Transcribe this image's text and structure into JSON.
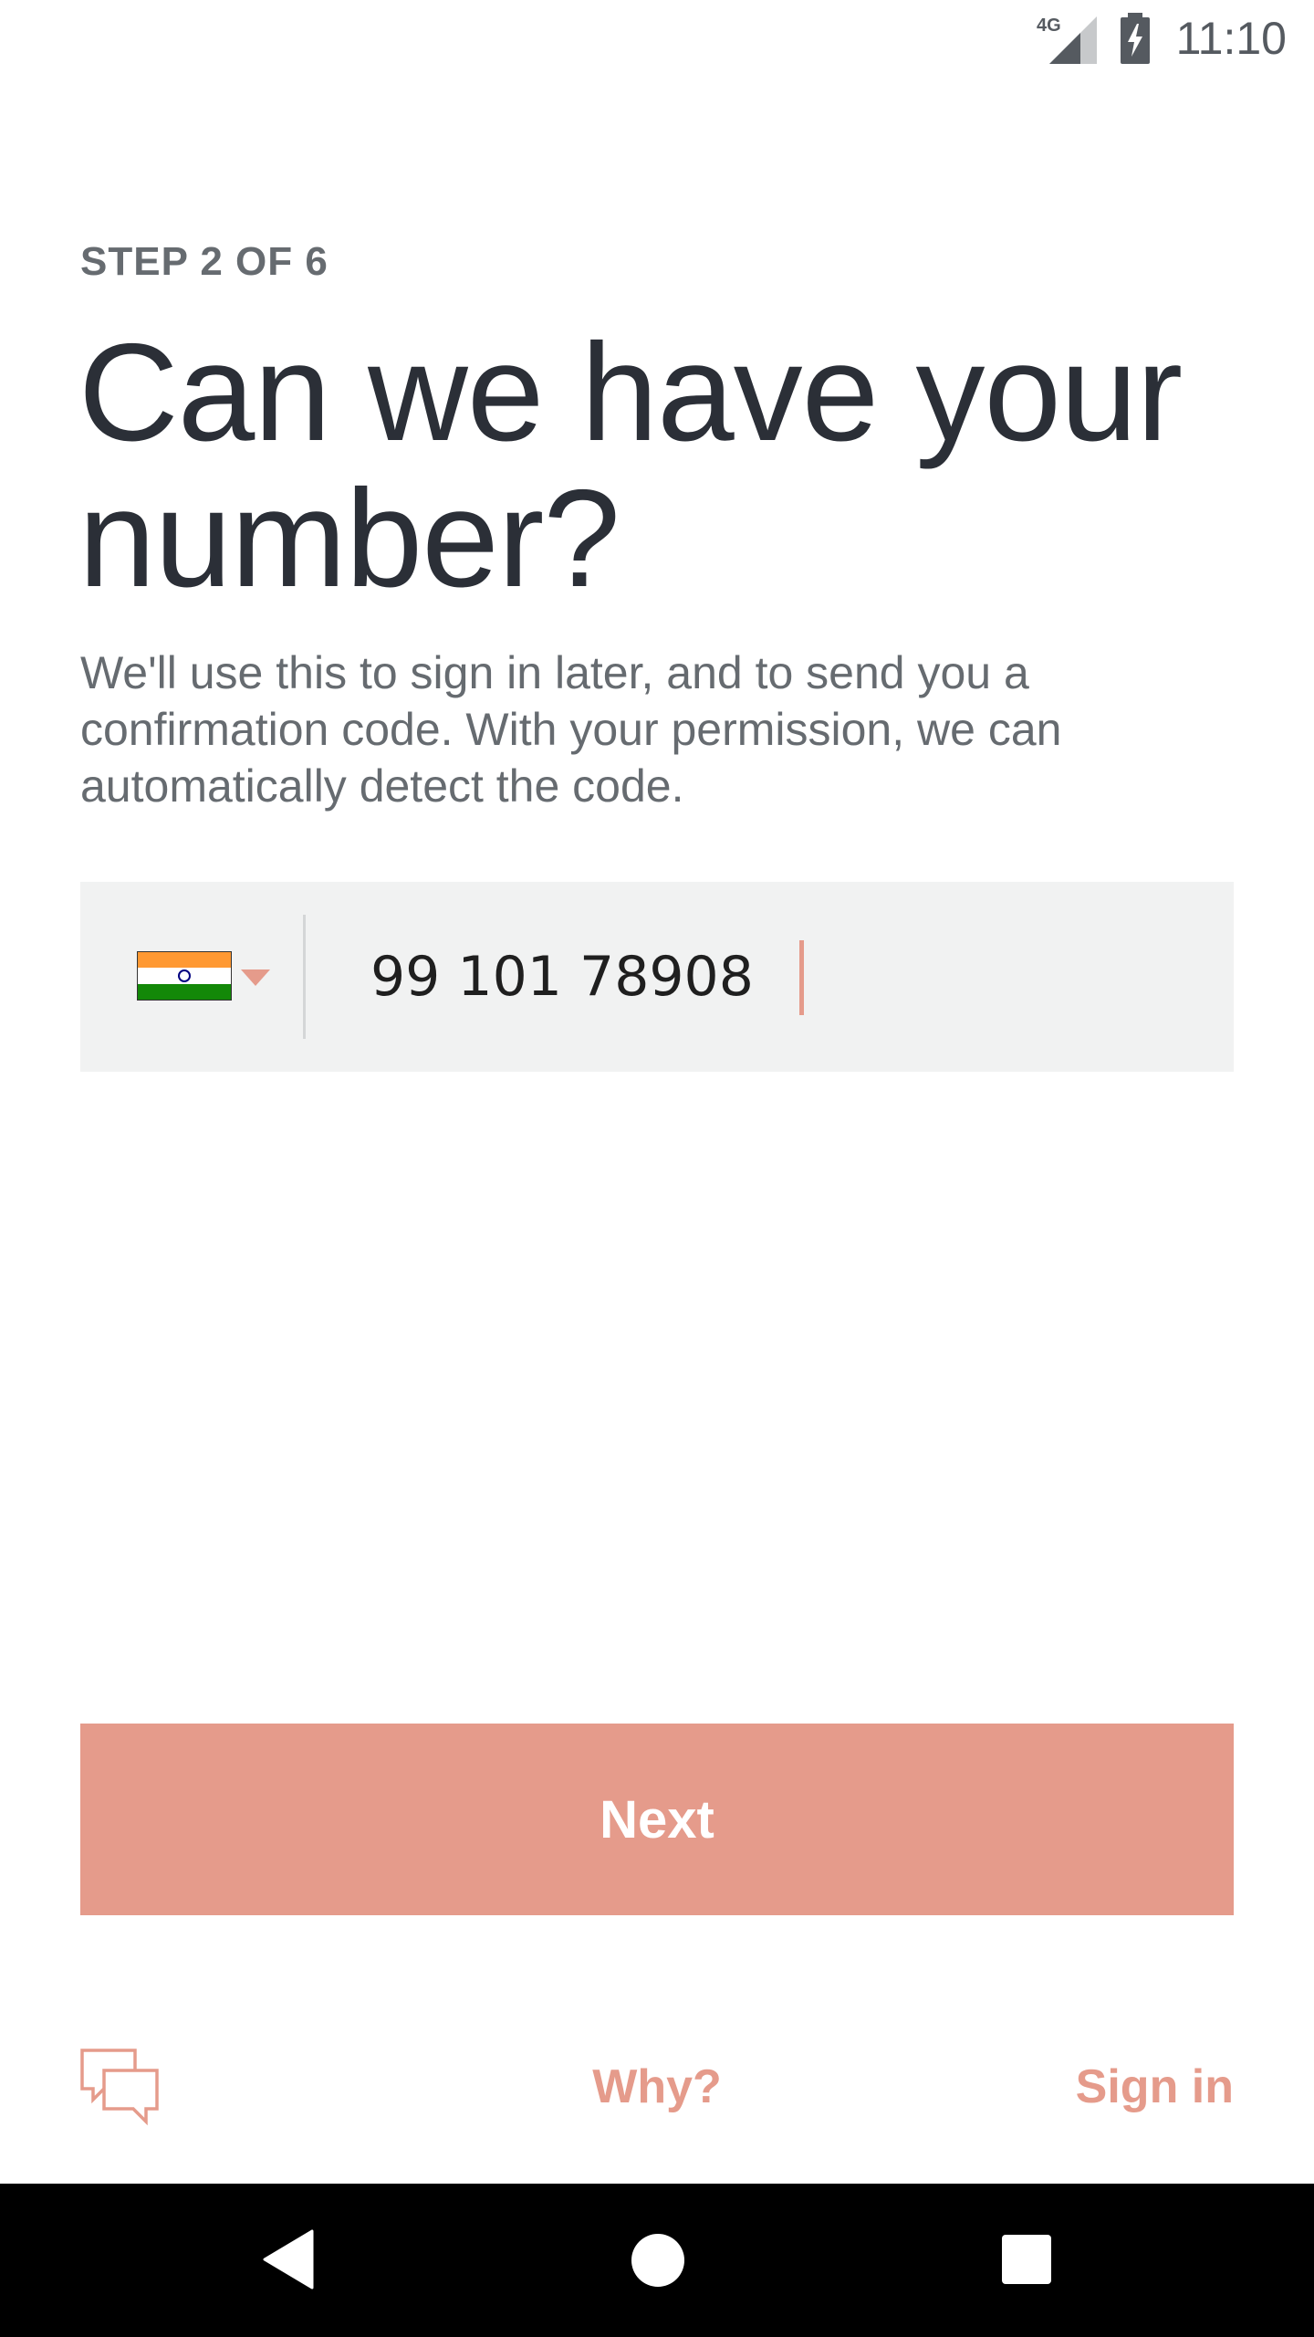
{
  "status_bar": {
    "network_label": "4G",
    "time": "11:10",
    "signal_icon": "cell-signal-icon",
    "battery_icon": "battery-charging-icon"
  },
  "step_label": "STEP 2 OF 6",
  "headline": "Can we have your number?",
  "description": "We'll use this to sign in later, and to send you a confirmation code. With your permission, we can automatically detect the code.",
  "phone_field": {
    "country_flag_icon": "india-flag-icon",
    "dropdown_icon": "chevron-down-icon",
    "value": "99 101 78908"
  },
  "next_button_label": "Next",
  "footer": {
    "chat_icon": "chat-bubbles-icon",
    "why_label": "Why?",
    "signin_label": "Sign in"
  },
  "nav_bar": {
    "back_icon": "back-triangle-icon",
    "home_icon": "home-circle-icon",
    "recents_icon": "recents-square-icon"
  },
  "colors": {
    "accent": "#e59b8b",
    "headline": "#2b2f37",
    "body_text": "#666b70",
    "field_background": "#f1f2f2"
  }
}
